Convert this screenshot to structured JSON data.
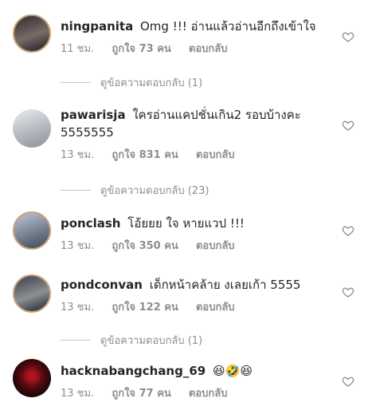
{
  "comments": [
    {
      "username": "ningpanita",
      "text": "Omg !!! อ่านแล้วอ่านอีกถึงเข้าใจ",
      "time": "11 ชม.",
      "likes": "ถูกใจ 73 คน",
      "reply_label": "ตอบกลับ",
      "view_replies": "ดูข้อความตอบกลับ (1)"
    },
    {
      "username": "pawarisja",
      "text": "ใครอ่านแคปชั่นเกิน2 รอบบ้างคะ 5555555",
      "time": "13 ชม.",
      "likes": "ถูกใจ 831 คน",
      "reply_label": "ตอบกลับ",
      "view_replies": "ดูข้อความตอบกลับ (23)"
    },
    {
      "username": "ponclash",
      "text": "โอ้ยยย ใจ หายแวป !!!",
      "time": "13 ชม.",
      "likes": "ถูกใจ 350 คน",
      "reply_label": "ตอบกลับ"
    },
    {
      "username": "pondconvan",
      "text": "เด็กหน้าคล้าย งเลยเก้า 5555",
      "time": "13 ชม.",
      "likes": "ถูกใจ 122 คน",
      "reply_label": "ตอบกลับ",
      "view_replies": "ดูข้อความตอบกลับ (1)"
    },
    {
      "username": "hacknabangchang_69",
      "text": "😆🤣😆",
      "time": "13 ชม.",
      "likes": "ถูกใจ 77 คน",
      "reply_label": "ตอบกลับ"
    }
  ],
  "icons": {
    "like": "heart-outline-icon"
  },
  "colors": {
    "text": "#262626",
    "meta": "#8e8e8e",
    "divider": "#c7c7c7"
  }
}
